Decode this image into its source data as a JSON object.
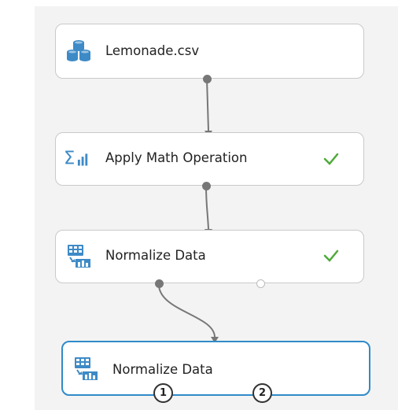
{
  "modules": [
    {
      "label": "Lemonade.csv",
      "icon": "dataset-icon",
      "status": ""
    },
    {
      "label": "Apply Math Operation",
      "icon": "sigma-chart-icon",
      "status": "completed"
    },
    {
      "label": "Normalize Data",
      "icon": "normalize-data-icon",
      "status": "completed"
    },
    {
      "label": "Normalize Data",
      "icon": "normalize-data-icon",
      "status": ""
    }
  ],
  "ports": {
    "output_1": "1",
    "output_2": "2"
  },
  "colors": {
    "canvas_background": "#f3f3f3",
    "module_border": "#c9c9c9",
    "selected_border": "#2f8bc9",
    "icon_blue": "#3d8ac7",
    "check_green": "#4faa3a",
    "connector_gray": "#777777"
  }
}
